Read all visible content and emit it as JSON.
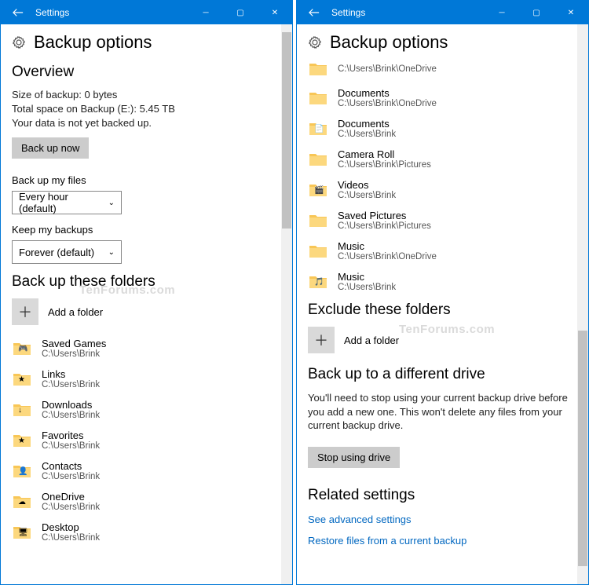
{
  "app": {
    "title": "Settings"
  },
  "page": {
    "title": "Backup options"
  },
  "left": {
    "overview_h": "Overview",
    "size_line": "Size of backup: 0 bytes",
    "space_line": "Total space on Backup (E:): 5.45 TB",
    "status_line": "Your data is not yet backed up.",
    "backup_now": "Back up now",
    "freq_label": "Back up my files",
    "freq_value": "Every hour (default)",
    "keep_label": "Keep my backups",
    "keep_value": "Forever (default)",
    "folders_h": "Back up these folders",
    "add_folder": "Add a folder",
    "folders": [
      {
        "name": "Saved Games",
        "path": "C:\\Users\\Brink",
        "icon": "folder-gamepad"
      },
      {
        "name": "Links",
        "path": "C:\\Users\\Brink",
        "icon": "folder-star"
      },
      {
        "name": "Downloads",
        "path": "C:\\Users\\Brink",
        "icon": "folder-down"
      },
      {
        "name": "Favorites",
        "path": "C:\\Users\\Brink",
        "icon": "folder-star"
      },
      {
        "name": "Contacts",
        "path": "C:\\Users\\Brink",
        "icon": "folder-contact"
      },
      {
        "name": "OneDrive",
        "path": "C:\\Users\\Brink",
        "icon": "folder-cloud"
      },
      {
        "name": "Desktop",
        "path": "C:\\Users\\Brink",
        "icon": "folder-desktop"
      }
    ]
  },
  "right": {
    "top_path": "C:\\Users\\Brink\\OneDrive",
    "folders": [
      {
        "name": "Documents",
        "path": "C:\\Users\\Brink\\OneDrive",
        "icon": "folder"
      },
      {
        "name": "Documents",
        "path": "C:\\Users\\Brink",
        "icon": "folder-doc"
      },
      {
        "name": "Camera Roll",
        "path": "C:\\Users\\Brink\\Pictures",
        "icon": "folder"
      },
      {
        "name": "Videos",
        "path": "C:\\Users\\Brink",
        "icon": "folder-video"
      },
      {
        "name": "Saved Pictures",
        "path": "C:\\Users\\Brink\\Pictures",
        "icon": "folder"
      },
      {
        "name": "Music",
        "path": "C:\\Users\\Brink\\OneDrive",
        "icon": "folder"
      },
      {
        "name": "Music",
        "path": "C:\\Users\\Brink",
        "icon": "folder-music"
      }
    ],
    "exclude_h": "Exclude these folders",
    "add_folder": "Add a folder",
    "diff_h": "Back up to a different drive",
    "diff_text": "You'll need to stop using your current backup drive before you add a new one. This won't delete any files from your current backup drive.",
    "stop_btn": "Stop using drive",
    "related_h": "Related settings",
    "link1": "See advanced settings",
    "link2": "Restore files from a current backup"
  },
  "watermark": "TenForums.com"
}
